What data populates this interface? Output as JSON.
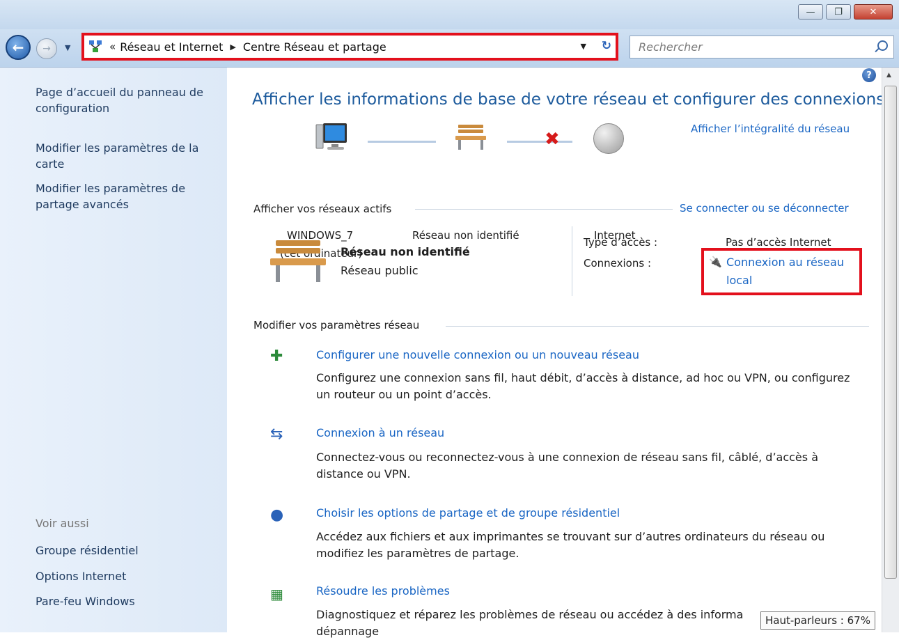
{
  "window": {
    "buttons": {
      "minimize": "—",
      "restore": "❐",
      "close": "✕"
    }
  },
  "address_bar": {
    "chevron": "«",
    "crumbs": [
      "Réseau et Internet",
      "Centre Réseau et partage"
    ],
    "separator": "▶",
    "dropdown": "▼",
    "refresh": "↻"
  },
  "search": {
    "placeholder": "Rechercher"
  },
  "sidebar": {
    "links": [
      "Page d’accueil du panneau de configuration",
      "Modifier les paramètres de la carte",
      "Modifier les paramètres de partage avancés"
    ],
    "see_also_label": "Voir aussi",
    "see_also": [
      "Groupe résidentiel",
      "Options Internet",
      "Pare-feu Windows"
    ]
  },
  "main": {
    "title": "Afficher les informations de base de votre réseau et configurer des connexions",
    "full_map_link": "Afficher l’intégralité du réseau",
    "map": {
      "computer_name": "WINDOWS_7",
      "computer_sub": "(cet ordinateur)",
      "network_name": "Réseau non identifié",
      "internet_label": "Internet"
    },
    "active_networks": {
      "heading": "Afficher vos réseaux actifs",
      "connect_link": "Se connecter ou se déconnecter",
      "network_name": "Réseau non identifié",
      "network_type": "Réseau public",
      "access_type_label": "Type d’accès :",
      "access_type_value": "Pas d’accès Internet",
      "connections_label": "Connexions :",
      "connection_link_line1": "Connexion au réseau",
      "connection_link_line2": "local"
    },
    "change_settings": {
      "heading": "Modifier vos paramètres réseau",
      "tasks": [
        {
          "title": "Configurer une nouvelle connexion ou un nouveau réseau",
          "desc": "Configurez une connexion sans fil, haut débit, d’accès à distance, ad hoc ou VPN, ou configurez un routeur ou un point d’accès."
        },
        {
          "title": "Connexion à un réseau",
          "desc": "Connectez-vous ou reconnectez-vous à une connexion de réseau sans fil, câblé, d’accès à distance ou VPN."
        },
        {
          "title": "Choisir les options de partage et de groupe résidentiel",
          "desc": "Accédez aux fichiers et aux imprimantes se trouvant sur d’autres ordinateurs du réseau ou modifiez les paramètres de partage."
        },
        {
          "title": "Résoudre les problèmes",
          "desc": "Diagnostiquez et réparez les problèmes de réseau ou accédez à des informa"
        }
      ],
      "last_line_fragment": "dépannage"
    }
  },
  "tooltip": "Haut-parleurs : 67%",
  "help_icon": "?",
  "colors": {
    "accent": "#1a66c4",
    "title_blue": "#1c5a9c",
    "highlight_red": "#e3101c"
  }
}
